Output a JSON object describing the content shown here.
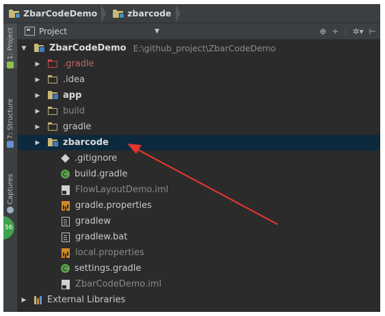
{
  "breadcrumb": [
    {
      "label": "ZbarCodeDemo"
    },
    {
      "label": "zbarcode"
    }
  ],
  "left_strip": {
    "tabs": [
      {
        "label": "1: Project",
        "active": true
      },
      {
        "label": "7: Structure",
        "active": false
      },
      {
        "label": "Captures",
        "active": false
      }
    ],
    "badge": "56"
  },
  "panel": {
    "title": "Project",
    "actions": [
      "target-icon",
      "collapse-icon",
      "settings-icon",
      "hide-icon"
    ]
  },
  "tree": {
    "root": {
      "label": "ZbarCodeDemo",
      "path": "E:\\github_project\\ZbarCodeDemo"
    },
    "items": [
      {
        "label": ".gradle",
        "kind": "folder-excluded"
      },
      {
        "label": ".idea",
        "kind": "folder"
      },
      {
        "label": "app",
        "kind": "module"
      },
      {
        "label": "build",
        "kind": "folder-dim"
      },
      {
        "label": "gradle",
        "kind": "folder"
      },
      {
        "label": "zbarcode",
        "kind": "module",
        "selected": true
      },
      {
        "label": ".gitignore",
        "kind": "gitignore"
      },
      {
        "label": "build.gradle",
        "kind": "gradle"
      },
      {
        "label": "FlowLayoutDemo.iml",
        "kind": "iml-dim"
      },
      {
        "label": "gradle.properties",
        "kind": "properties"
      },
      {
        "label": "gradlew",
        "kind": "text"
      },
      {
        "label": "gradlew.bat",
        "kind": "text"
      },
      {
        "label": "local.properties",
        "kind": "properties-dim"
      },
      {
        "label": "settings.gradle",
        "kind": "gradle"
      },
      {
        "label": "ZbarCodeDemo.iml",
        "kind": "iml-dim"
      }
    ],
    "external": {
      "label": "External Libraries"
    }
  },
  "colors": {
    "background": "#2b2b2b",
    "selection": "#0d293e",
    "annotation_arrow": "#e0352b"
  }
}
